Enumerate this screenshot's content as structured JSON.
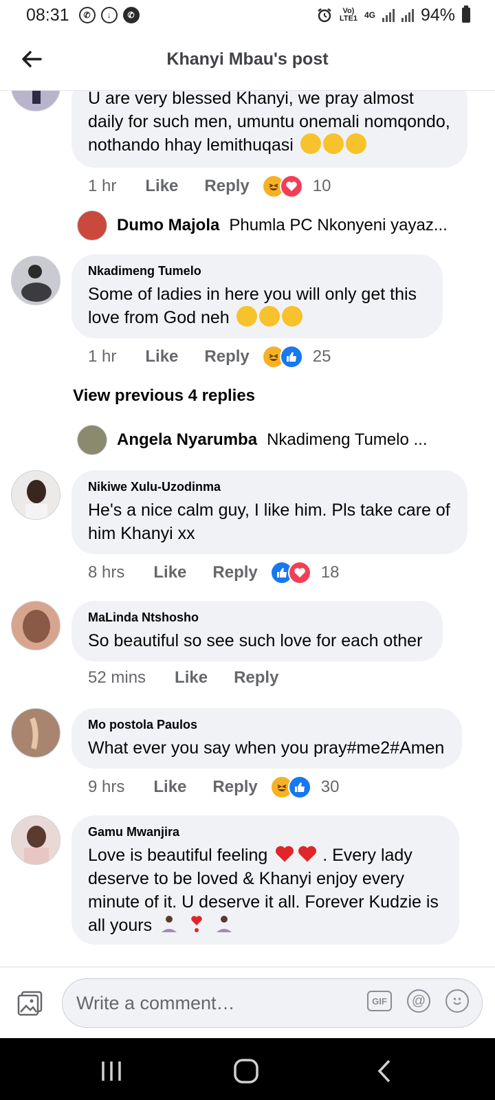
{
  "status_bar": {
    "time": "08:31",
    "network_top": "Vo)",
    "network_bottom": "LTE1",
    "gen": "4G",
    "battery": "94%"
  },
  "header": {
    "title": "Khanyi Mbau's post"
  },
  "comments": [
    {
      "text": "U are very blessed Khanyi, we pray almost daily for such men, umuntu onemali nomqondo, nothando hhay lemithuqasi",
      "emojis": [
        "crying-face",
        "crying-face",
        "crying-face"
      ],
      "time": "1 hr",
      "like": "Like",
      "reply": "Reply",
      "reactions": [
        "haha",
        "love"
      ],
      "reaction_count": "10"
    },
    {
      "name": "Nkadimeng Tumelo",
      "text": "Some of  ladies in here  you will only get this love from God neh",
      "emojis": [
        "rofl-face",
        "rofl-face",
        "rofl-face"
      ],
      "time": "1 hr",
      "like": "Like",
      "reply": "Reply",
      "reactions": [
        "haha",
        "like"
      ],
      "reaction_count": "25"
    },
    {
      "name": "Nikiwe Xulu-Uzodinma",
      "text": "He's a nice calm guy, I like him. Pls take care of him Khanyi xx",
      "time": "8 hrs",
      "like": "Like",
      "reply": "Reply",
      "reactions": [
        "like",
        "love"
      ],
      "reaction_count": "18"
    },
    {
      "name": "MaLinda Ntshosho",
      "text": "So beautiful so see such love for each other",
      "time": "52 mins",
      "like": "Like",
      "reply": "Reply"
    },
    {
      "name": "Mo postola Paulos",
      "text": "What ever you say when you pray#me2#Amen",
      "time": "9 hrs",
      "like": "Like",
      "reply": "Reply",
      "reactions": [
        "haha",
        "like"
      ],
      "reaction_count": "30"
    },
    {
      "name": "Gamu Mwanjira",
      "text_1": "Love is beautiful feeling",
      "text_2": ". Every lady deserve to be loved & Khanyi enjoy every minute of it. U deserve it all.  Forever Kudzie is all yours"
    }
  ],
  "reply_previews": [
    {
      "name": "Dumo Majola",
      "text": "Phumla PC Nkonyeni yayaz..."
    },
    {
      "name": "Angela Nyarumba",
      "text": "Nkadimeng Tumelo ..."
    }
  ],
  "view_previous": "View previous 4 replies",
  "composer": {
    "placeholder": "Write a comment…",
    "gif_label": "GIF"
  },
  "colors": {
    "bubble": "#f0f2f5",
    "meta_text": "#65676b",
    "like_blue": "#1877f2",
    "love_red": "#f33e58",
    "haha_yellow": "#f7b125"
  }
}
